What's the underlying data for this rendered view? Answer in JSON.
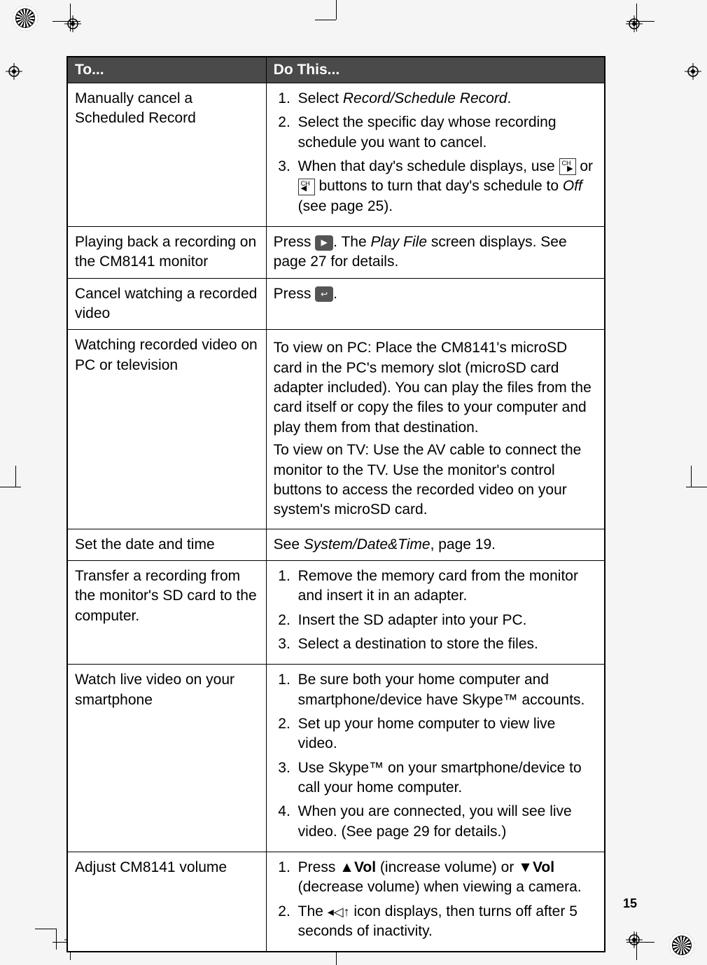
{
  "page_number": "15",
  "headers": {
    "col1": "To...",
    "col2": "Do This..."
  },
  "rows": {
    "r1": {
      "to": "Manually cancel a Scheduled Record",
      "steps": [
        {
          "pre": "Select ",
          "italic": "Record/Schedule Record",
          "post": "."
        },
        {
          "text": "Select the specific day whose recording schedule you want to cancel."
        },
        {
          "pre": "When that day's schedule displays, use ",
          "mid": " or ",
          "post_pre": " buttons to turn that day's schedule to ",
          "off_italic": "Off",
          "post": " (see page 25)."
        }
      ]
    },
    "r2": {
      "to": "Playing back a recording on the CM8141 monitor",
      "pre": "Press ",
      "mid": ". The ",
      "italic": "Play File",
      "post": " screen displays. See page 27 for details."
    },
    "r3": {
      "to": "Cancel watching a recorded video",
      "pre": "Press ",
      "post": "."
    },
    "r4": {
      "to": "Watching recorded video on PC or television",
      "p1": "To view on PC:  Place the CM8141's microSD card in the PC's memory slot (microSD card adapter included). You can play the files from the card itself or copy the files to your computer and play them from that destination.",
      "p2": "To view on TV:  Use the AV cable to connect the monitor to the TV. Use the monitor's control buttons to access the recorded video on your system's microSD card."
    },
    "r5": {
      "to": "Set the date and time",
      "pre": "See ",
      "italic": "System/Date&Time",
      "post": ", page 19."
    },
    "r6": {
      "to": "Transfer a recording from the monitor's SD card to the computer.",
      "steps": [
        "Remove the memory card from the monitor and insert it in an adapter.",
        "Insert the SD adapter into your PC.",
        "Select a destination to store the files."
      ]
    },
    "r7": {
      "to": "Watch live video on your smartphone",
      "steps": [
        "Be sure both your home computer and smartphone/device have Skype™ accounts.",
        "Set up your home computer to view live video.",
        "Use Skype™ on your smartphone/device to call your home computer.",
        "When you are connected, you will see live video. (See page 29 for details.)"
      ]
    },
    "r8": {
      "to": "Adjust CM8141 volume",
      "s1": {
        "pre": "Press ",
        "vol_up": "▲Vol",
        "mid": "  (increase volume) or ",
        "vol_dn": "▼Vol",
        "post": " (decrease volume) when viewing a camera."
      },
      "s2": {
        "pre": "The ",
        "post": " icon displays, then turns off after 5 seconds of inactivity."
      }
    }
  }
}
